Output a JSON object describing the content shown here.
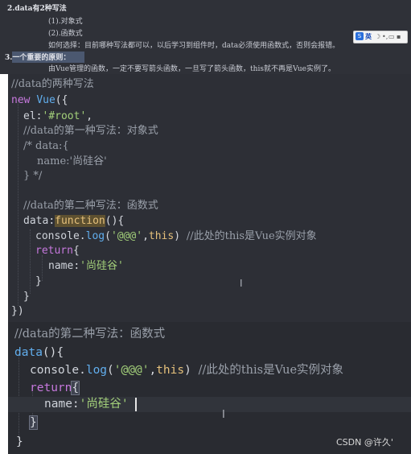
{
  "notes": {
    "line1": "2.data有2种写法",
    "line2": "(1).对象式",
    "line3": "(2).函数式",
    "line4": "如何选择：目前哪种写法都可以，以后学习到组件时，data必须使用函数式，否则会报错。",
    "line5": "3.一个重要的原则：",
    "line6": "由Vue管理的函数，一定不要写箭头函数，一旦写了箭头函数，this就不再是Vue实例了。"
  },
  "ime": {
    "lang": "英",
    "s": "S"
  },
  "code1": {
    "comment_title": "//data的两种写法",
    "new_kw": "new",
    "vue": "Vue",
    "open": "({",
    "el_key": "el",
    "el_val": "'#root'",
    "comment_obj": "//data的第一种写法：对象式",
    "block_comment_1": "/* data:{",
    "block_comment_2": "name:'尚硅谷'",
    "block_comment_3": "} */",
    "comment_fn": "//data的第二种写法：函数式",
    "data_key": "data",
    "function_kw": "function",
    "fn_parens": "(){",
    "console": "console",
    "log": "log",
    "log_arg_str": "'@@@'",
    "log_arg_this": "this",
    "log_comment": "//此处的this是Vue实例对象",
    "return_kw": "return",
    "brace_open": "{",
    "name_key": "name",
    "name_val": "'尚硅谷'",
    "brace_close": "}",
    "close_all": "})"
  },
  "code2": {
    "comment_fn": "//data的第二种写法：函数式",
    "data_fn": "data",
    "fn_parens": "(){",
    "console": "console",
    "log": "log",
    "log_arg_str": "'@@@'",
    "log_arg_this": "this",
    "log_comment": "//此处的this是Vue实例对象",
    "return_kw": "return",
    "brace_open": "{",
    "name_key": "name",
    "name_val": "'尚硅谷'",
    "brace_close": "}"
  },
  "cursor_glyph": "I",
  "watermark": "CSDN @许久'"
}
